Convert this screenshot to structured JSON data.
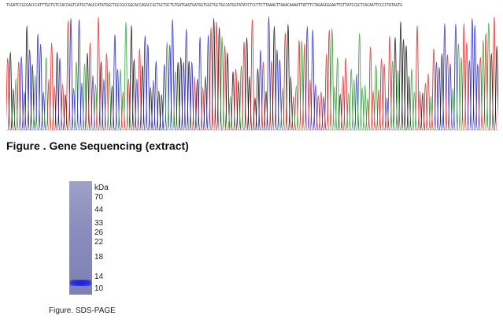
{
  "sequence": {
    "bases_text": "TGGATCCGCGACCCATTTGCTGTCCACCAGTCATGCTAGCCATATGGCTGCCGCCGGCACCAGGCCGCTGCTGCTGTGATGAGTGATGGTGGCTGCTGCCATGGTATATCTCCTTCTTAAAGTTAAACAAAATTATTTCTAGAGGGGAATTGTTATCCGCTCACAATTCCCCTATAGTG",
    "trace_colors": {
      "A": "#2ca02c",
      "C": "#2323c8",
      "G": "#111111",
      "T": "#e02020"
    }
  },
  "figure1": {
    "caption": "Figure . Gene Sequencing (extract)"
  },
  "gel": {
    "unit": "kDa",
    "markers": [
      "70",
      "44",
      "33",
      "26",
      "22",
      "18",
      "14",
      "10"
    ],
    "band_color": "#1b1fd9"
  },
  "figure2": {
    "caption": "Figure. SDS-PAGE"
  }
}
